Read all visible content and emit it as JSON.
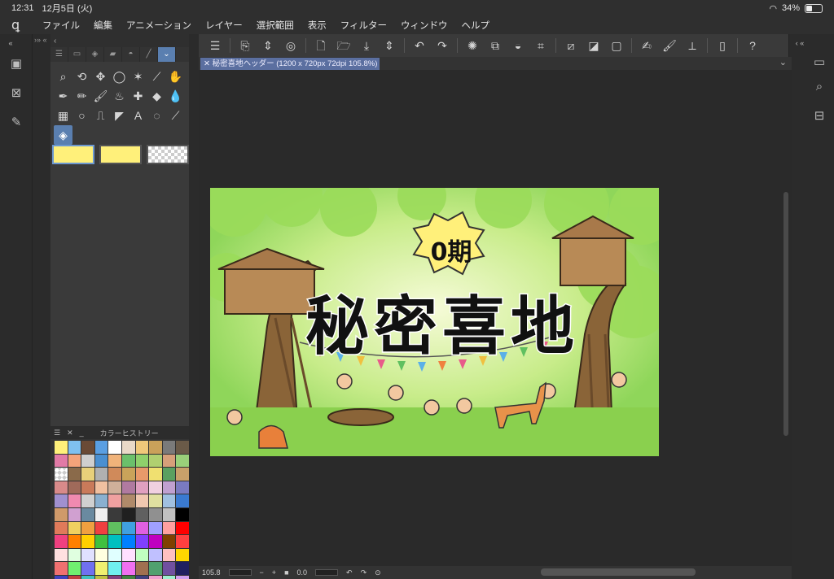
{
  "status": {
    "time": "12:31",
    "date": "12月5日 (火)",
    "battery": "34%"
  },
  "menu": [
    "ファイル",
    "編集",
    "アニメーション",
    "レイヤー",
    "選択範囲",
    "表示",
    "フィルター",
    "ウィンドウ",
    "ヘルプ"
  ],
  "tool_panel": {
    "tools": [
      "zoom-icon",
      "rotate-view-icon",
      "move-icon",
      "lasso-icon",
      "auto-select-icon",
      "eyedropper-icon",
      "hand-icon",
      "pen-icon",
      "pencil-icon",
      "brush-icon",
      "airbrush-icon",
      "decoration-icon",
      "eraser-icon",
      "blend-icon",
      "gradient-icon",
      "figure-icon",
      "ruler-icon",
      "frame-icon",
      "text-icon",
      "balloon-icon",
      "correction-icon",
      "fill-icon"
    ],
    "active_tool": 21
  },
  "history_panel": {
    "title": "カラーヒストリー",
    "colors": [
      "#fff07a",
      "#7fc0ef",
      "#6a4a36",
      "#5a9fe3",
      "#ffffff",
      "#e9d9c8",
      "#f0c87a",
      "#caa15a",
      "#7a7a7a",
      "#6a5a48",
      "#e17aa6",
      "#f4a37a",
      "#cfcfcf",
      "#4a8fd1",
      "#f0b37a",
      "#6bc06b",
      "#8fd06b",
      "#b0d070",
      "#d7a07a",
      "#9ad07a",
      "checker",
      "#8a6a4a",
      "#e8d07a",
      "#b0b0b0",
      "#d08a5a",
      "#c9a35a",
      "#e89a6a",
      "#f0e070",
      "#5aa060",
      "#c8a06a",
      "#d88a8a",
      "#a06a5a",
      "#c97a5a",
      "#f0c0a0",
      "#d0b09a",
      "#b07aa0",
      "#e0a0c0",
      "#f0d0e0",
      "#c0a0d0",
      "#7a7ac0",
      "#a090d0",
      "#f08ab0",
      "#d0d0d0",
      "#8ab0d0",
      "#f0a0a0",
      "#b08a6a",
      "#f0c8b0",
      "#e0e0a0",
      "#a0c0e0",
      "#3a7ad0",
      "#d09a6a",
      "#d0a0d0",
      "#6a8aa0",
      "#f0f0f0",
      "#3a3a3a",
      "#202020",
      "#606060",
      "#909090",
      "#c0c0c0",
      "#000000",
      "#e07a5a",
      "#f0d060",
      "#f0a040",
      "#f04040",
      "#60c060",
      "#40a0e0",
      "#e060e0",
      "#a0a0ff",
      "#ffa0a0",
      "#ff0000",
      "#f04080",
      "#ff8000",
      "#ffd000",
      "#40c040",
      "#00c0c0",
      "#0080ff",
      "#8040ff",
      "#c000c0",
      "#804000",
      "#ff4040",
      "#ffe0e0",
      "#e0ffe0",
      "#e0e0ff",
      "#ffffe0",
      "#e0ffff",
      "#ffe0ff",
      "#c0ffc0",
      "#c0c0ff",
      "#ffc0c0",
      "#ffd700",
      "#f07070",
      "#70f070",
      "#7070f0",
      "#f0f070",
      "#70f0f0",
      "#f070f0",
      "#a07050",
      "#50a070",
      "#7050a0",
      "#202060",
      "#4040c0",
      "#c04040",
      "#40c0c0",
      "#c0c040",
      "#804080",
      "#408040",
      "#404080",
      "#f0a0d0",
      "#a0f0d0",
      "#d0a0f0"
    ]
  },
  "doc_tab": {
    "label": "秘密喜地ヘッダー (1200 x 720px 72dpi 105.8%)"
  },
  "artwork": {
    "badge": "0期",
    "title": "秘密喜地"
  },
  "bottom": {
    "zoom": "105.8",
    "angle": "0.0"
  }
}
